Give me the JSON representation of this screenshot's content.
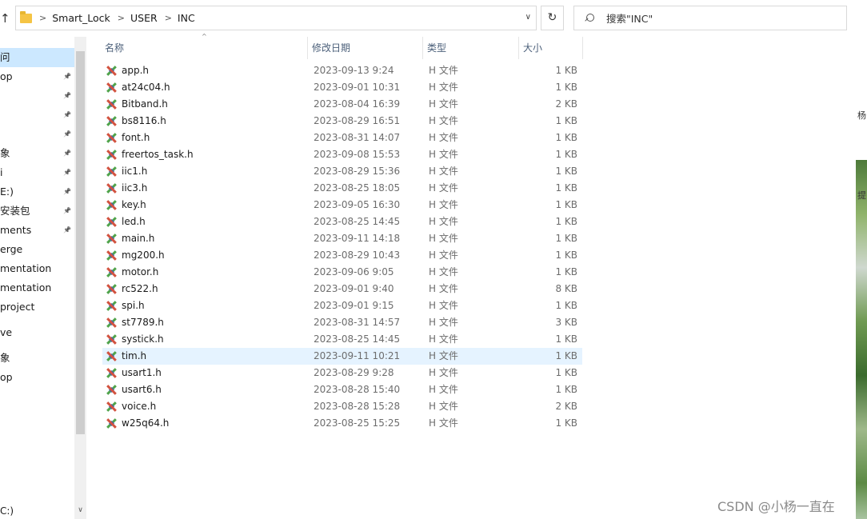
{
  "address_bar": {
    "breadcrumbs": [
      "Smart_Lock",
      "USER",
      "INC"
    ],
    "search_placeholder": "搜索\"INC\"",
    "refresh_glyph": "↻",
    "dropdown_glyph": "∨",
    "up_glyph": "↑"
  },
  "nav": {
    "items": [
      {
        "label": "问",
        "pinned": false,
        "state": "selected"
      },
      {
        "label": "op",
        "pinned": true,
        "state": ""
      },
      {
        "label": "",
        "pinned": true,
        "state": ""
      },
      {
        "label": "",
        "pinned": true,
        "state": ""
      },
      {
        "label": "",
        "pinned": true,
        "state": ""
      },
      {
        "label": "象",
        "pinned": true,
        "state": ""
      },
      {
        "label": "i",
        "pinned": true,
        "state": ""
      },
      {
        "label": "E:)",
        "pinned": true,
        "state": ""
      },
      {
        "label": "安装包",
        "pinned": true,
        "state": ""
      },
      {
        "label": "ments",
        "pinned": true,
        "state": ""
      },
      {
        "label": "erge",
        "pinned": false,
        "state": ""
      },
      {
        "label": "mentation",
        "pinned": false,
        "state": ""
      },
      {
        "label": "mentation",
        "pinned": false,
        "state": ""
      },
      {
        "label": "project",
        "pinned": false,
        "state": ""
      },
      {
        "label": "ve",
        "pinned": false,
        "state": "gap-before"
      },
      {
        "label": "象",
        "pinned": false,
        "state": "gap-before"
      },
      {
        "label": "op",
        "pinned": false,
        "state": ""
      }
    ],
    "bottom_label": "C:)"
  },
  "columns": {
    "name": "名称",
    "date": "修改日期",
    "type": "类型",
    "size": "大小"
  },
  "files": [
    {
      "name": "app.h",
      "date": "2023-09-13 9:24",
      "type": "H 文件",
      "size": "1 KB"
    },
    {
      "name": "at24c04.h",
      "date": "2023-09-01 10:31",
      "type": "H 文件",
      "size": "1 KB"
    },
    {
      "name": "Bitband.h",
      "date": "2023-08-04 16:39",
      "type": "H 文件",
      "size": "2 KB"
    },
    {
      "name": "bs8116.h",
      "date": "2023-08-29 16:51",
      "type": "H 文件",
      "size": "1 KB"
    },
    {
      "name": "font.h",
      "date": "2023-08-31 14:07",
      "type": "H 文件",
      "size": "1 KB"
    },
    {
      "name": "freertos_task.h",
      "date": "2023-09-08 15:53",
      "type": "H 文件",
      "size": "1 KB"
    },
    {
      "name": "iic1.h",
      "date": "2023-08-29 15:36",
      "type": "H 文件",
      "size": "1 KB"
    },
    {
      "name": "iic3.h",
      "date": "2023-08-25 18:05",
      "type": "H 文件",
      "size": "1 KB"
    },
    {
      "name": "key.h",
      "date": "2023-09-05 16:30",
      "type": "H 文件",
      "size": "1 KB"
    },
    {
      "name": "led.h",
      "date": "2023-08-25 14:45",
      "type": "H 文件",
      "size": "1 KB"
    },
    {
      "name": "main.h",
      "date": "2023-09-11 14:18",
      "type": "H 文件",
      "size": "1 KB"
    },
    {
      "name": "mg200.h",
      "date": "2023-08-29 10:43",
      "type": "H 文件",
      "size": "1 KB"
    },
    {
      "name": "motor.h",
      "date": "2023-09-06 9:05",
      "type": "H 文件",
      "size": "1 KB"
    },
    {
      "name": "rc522.h",
      "date": "2023-09-01 9:40",
      "type": "H 文件",
      "size": "8 KB"
    },
    {
      "name": "spi.h",
      "date": "2023-09-01 9:15",
      "type": "H 文件",
      "size": "1 KB"
    },
    {
      "name": "st7789.h",
      "date": "2023-08-31 14:57",
      "type": "H 文件",
      "size": "3 KB"
    },
    {
      "name": "systick.h",
      "date": "2023-08-25 14:45",
      "type": "H 文件",
      "size": "1 KB"
    },
    {
      "name": "tim.h",
      "date": "2023-09-11 10:21",
      "type": "H 文件",
      "size": "1 KB",
      "hover": true
    },
    {
      "name": "usart1.h",
      "date": "2023-08-29 9:28",
      "type": "H 文件",
      "size": "1 KB"
    },
    {
      "name": "usart6.h",
      "date": "2023-08-28 15:40",
      "type": "H 文件",
      "size": "1 KB"
    },
    {
      "name": "voice.h",
      "date": "2023-08-28 15:28",
      "type": "H 文件",
      "size": "2 KB"
    },
    {
      "name": "w25q64.h",
      "date": "2023-08-25 15:25",
      "type": "H 文件",
      "size": "1 KB"
    }
  ],
  "desktop_strip": {
    "glyphs": [
      "杨",
      "提"
    ]
  },
  "watermark": "CSDN @小杨一直在",
  "colors": {
    "selected_bg": "#cce8ff",
    "hover_bg": "#e5f3ff",
    "header_text": "#4c607a"
  }
}
